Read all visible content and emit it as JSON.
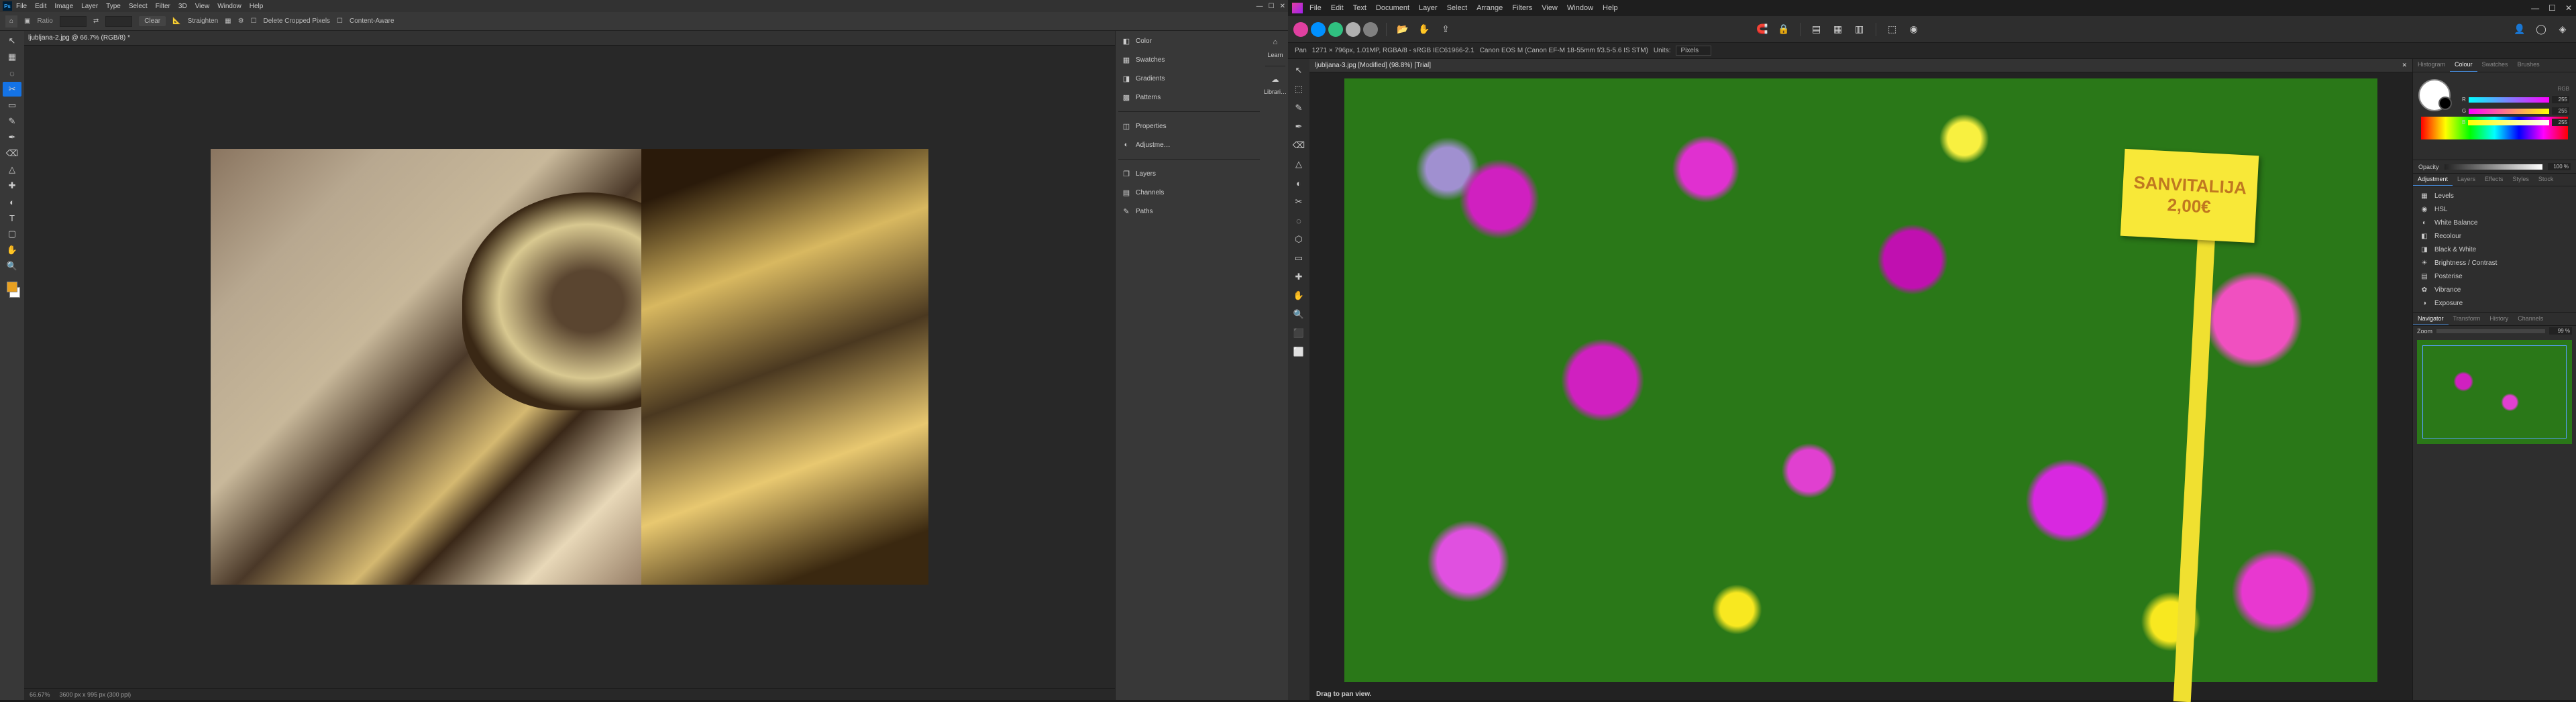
{
  "ps": {
    "menu": [
      "File",
      "Edit",
      "Image",
      "Layer",
      "Type",
      "Select",
      "Filter",
      "3D",
      "View",
      "Window",
      "Help"
    ],
    "options": {
      "ratio_label": "Ratio",
      "clear": "Clear",
      "straighten": "Straighten",
      "delete_cropped": "Delete Cropped Pixels",
      "content_aware": "Content-Aware"
    },
    "tab": "ljubljana-2.jpg @ 66.7% (RGB/8) *",
    "tools": [
      "↖",
      "▦",
      "◌",
      "✂",
      "▭",
      "✎",
      "✒",
      "⌫",
      "△",
      "✚",
      "◐",
      "T",
      "▢",
      "✋",
      "🔍"
    ],
    "swatch_fg": "#e8a020",
    "swatch_bg": "#ffffff",
    "panels_col1": [
      "Learn",
      "Librari…"
    ],
    "panels_col2": {
      "group1": [
        "Color",
        "Swatches",
        "Gradients",
        "Patterns"
      ],
      "group2": [
        "Properties",
        "Adjustme…"
      ],
      "group3": [
        "Layers",
        "Channels",
        "Paths"
      ]
    },
    "status": {
      "zoom": "66.67%",
      "doc": "3600 px x 995 px (300 ppi)"
    }
  },
  "af": {
    "menu": [
      "File",
      "Edit",
      "Text",
      "Document",
      "Layer",
      "Select",
      "Arrange",
      "Filters",
      "View",
      "Window",
      "Help"
    ],
    "personas": [
      "#e040a0",
      "#0090ff",
      "#30c080",
      "#b0b0b0",
      "#808080"
    ],
    "context": {
      "tool": "Pan",
      "size": "1271 × 796px, 1.01MP, RGBA/8 - sRGB IEC61966-2.1",
      "camera": "Canon EOS M (Canon EF-M 18-55mm f/3.5-5.6 IS STM)",
      "units_label": "Units:",
      "units_value": "Pixels"
    },
    "doc_tab": "ljubljana-3.jpg [Modified] (98.8%) [Trial]",
    "tools": [
      "↖",
      "⬚",
      "✎",
      "✒",
      "⌫",
      "△",
      "◐",
      "✂",
      "◌",
      "⬡",
      "▭",
      "✚",
      "✋",
      "🔍",
      "⬛",
      "⬜"
    ],
    "plant_label": {
      "line1": "SANVITALIJA",
      "line2": "2,00€"
    },
    "canvas_status": {
      "hint": "Drag to pan view."
    },
    "right": {
      "top_tabs": [
        "Histogram",
        "Colour",
        "Swatches",
        "Brushes"
      ],
      "rgb_label": "RGB",
      "rgb": {
        "r": "255",
        "g": "255",
        "b": "255"
      },
      "opacity_label": "Opacity",
      "opacity_value": "100 %",
      "adj_tabs": [
        "Adjustment",
        "Layers",
        "Effects",
        "Styles",
        "Stock"
      ],
      "adjustments": [
        "Levels",
        "HSL",
        "White Balance",
        "Recolour",
        "Black & White",
        "Brightness / Contrast",
        "Posterise",
        "Vibrance",
        "Exposure"
      ],
      "nav_tabs": [
        "Navigator",
        "Transform",
        "History",
        "Channels"
      ],
      "zoom_label": "Zoom",
      "zoom_value": "99 %"
    }
  }
}
